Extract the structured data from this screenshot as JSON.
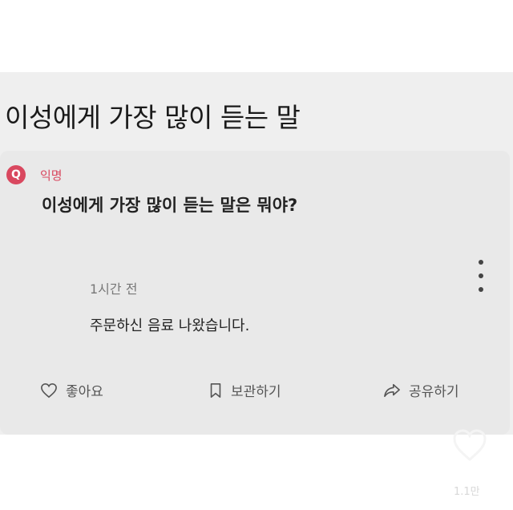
{
  "post": {
    "title": "이성에게 가장 많이 듣는 말"
  },
  "question_card": {
    "author_badge": "Q",
    "author_name": "익명",
    "question": "이성에게 가장 많이 듣는 말은 뭐야?",
    "more_icon": "more-vertical-icon"
  },
  "comment": {
    "time": "1시간 전",
    "text": "주문하신 음료 나왔습니다."
  },
  "actions": {
    "like_label": "좋아요",
    "save_label": "보관하기",
    "share_label": "공유하기"
  },
  "overlay": {
    "count_text": "1.1만"
  },
  "colors": {
    "accent": "#d9485f",
    "background": "#efefef",
    "text": "#1f1f1f"
  }
}
